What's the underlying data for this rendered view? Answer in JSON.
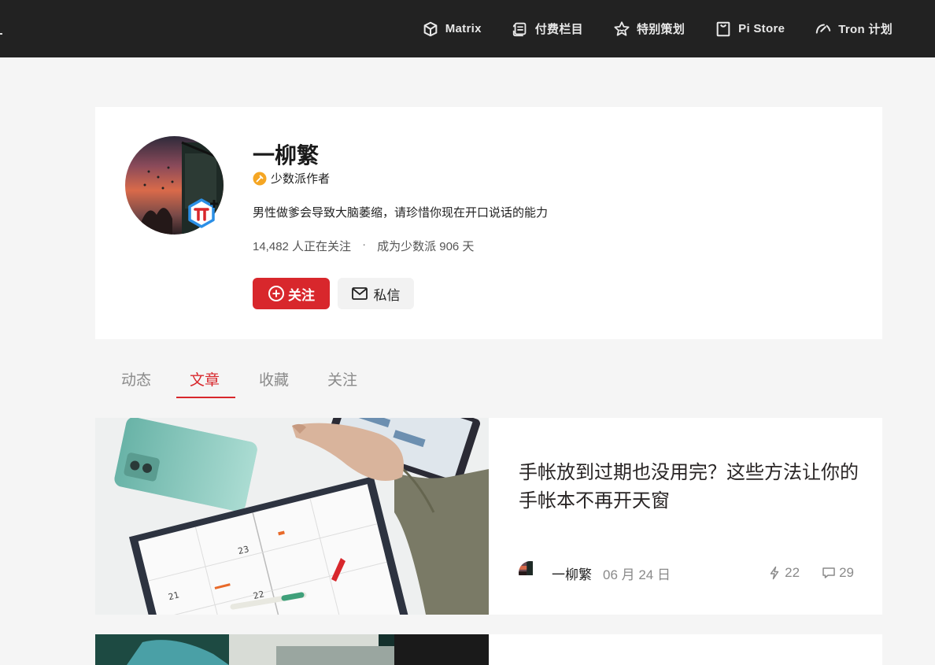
{
  "nav": {
    "items": [
      {
        "label": "Matrix",
        "icon": "matrix-icon"
      },
      {
        "label": "付费栏目",
        "icon": "paid-column-icon"
      },
      {
        "label": "特别策划",
        "icon": "star-icon"
      },
      {
        "label": "Pi Store",
        "icon": "store-bag-icon"
      },
      {
        "label": "Tron 计划",
        "icon": "tron-gauge-icon"
      }
    ]
  },
  "profile": {
    "name": "一柳繁",
    "role": "少数派作者",
    "bio": "男性做爹会导致大脑萎缩，请珍惜你现在开口说话的能力",
    "followers_text": "14,482 人正在关注",
    "member_text": "成为少数派 906 天",
    "separator": "·",
    "follow_label": "关注",
    "message_label": "私信"
  },
  "tabs": [
    {
      "label": "动态"
    },
    {
      "label": "文章",
      "active": true
    },
    {
      "label": "收藏"
    },
    {
      "label": "关注"
    }
  ],
  "articles": [
    {
      "title": "手帐放到过期也没用完？这些方法让你的手帐本不再开天窗",
      "author": "一柳繁",
      "date": "06 月 24 日",
      "likes": "22",
      "comments": "29"
    }
  ],
  "colors": {
    "accent": "#d8272c",
    "topbar": "#222222",
    "badge": "#f5a623"
  }
}
